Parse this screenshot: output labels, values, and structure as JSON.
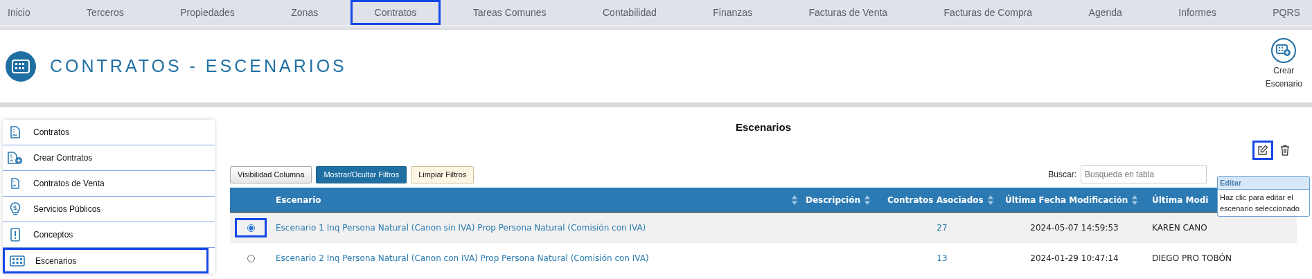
{
  "nav": [
    {
      "label": "Inicio",
      "selected": false
    },
    {
      "label": "Terceros",
      "selected": false
    },
    {
      "label": "Propiedades",
      "selected": false
    },
    {
      "label": "Zonas",
      "selected": false
    },
    {
      "label": "Contratos",
      "selected": true
    },
    {
      "label": "Tareas Comunes",
      "selected": false
    },
    {
      "label": "Contabilidad",
      "selected": false
    },
    {
      "label": "Finanzas",
      "selected": false
    },
    {
      "label": "Facturas de Venta",
      "selected": false
    },
    {
      "label": "Facturas de Compra",
      "selected": false
    },
    {
      "label": "Agenda",
      "selected": false
    },
    {
      "label": "Informes",
      "selected": false
    },
    {
      "label": "PQRS",
      "selected": false
    }
  ],
  "header": {
    "title": "CONTRATOS - ESCENARIOS",
    "create_button": [
      "Crear",
      "Escenario"
    ]
  },
  "sidebar": {
    "items": [
      {
        "label": "Contratos",
        "kind": "document",
        "selected": false
      },
      {
        "label": "Crear Contratos",
        "kind": "document-add",
        "selected": false
      },
      {
        "label": "Contratos de Venta",
        "kind": "document-small",
        "selected": false
      },
      {
        "label": "Servicios Públicos",
        "kind": "bulb",
        "selected": false
      },
      {
        "label": "Conceptos",
        "kind": "alert",
        "selected": false
      },
      {
        "label": "Escenarios",
        "kind": "grid",
        "selected": true
      }
    ]
  },
  "main": {
    "title": "Escenarios",
    "edit_highlighted": true,
    "buttons": [
      {
        "label": "Visibilidad Columna",
        "kind": "default"
      },
      {
        "label": "Mostrar/Ocultar Filtros",
        "kind": "primary"
      },
      {
        "label": "Limpiar Filtros",
        "kind": "warning"
      }
    ],
    "search": {
      "label": "Buscar:",
      "placeholder": "Busqueda en tabla"
    },
    "tooltip": {
      "title": "Editar",
      "text": "Haz clic para editar el escenario seleccionado"
    },
    "table": {
      "columns": [
        "Escenario",
        "Descripción",
        "Contratos Asociados",
        "Última Fecha Modificación",
        "Última Modi"
      ],
      "rows": [
        {
          "selected": true,
          "escenario": "Escenario 1 Inq Persona Natural (Canon sin IVA) Prop Persona Natural (Comisión con IVA)",
          "contratos": "27",
          "fecha": "2024-05-07 14:59:53",
          "usuario": "KAREN CANO"
        },
        {
          "selected": false,
          "escenario": "Escenario 2 Inq Persona Natural (Canon con IVA) Prop Persona Natural (Comisión con IVA)",
          "contratos": "13",
          "fecha": "2024-01-29 10:47:14",
          "usuario": "DIEGO PRO TOBÓN"
        }
      ]
    }
  }
}
